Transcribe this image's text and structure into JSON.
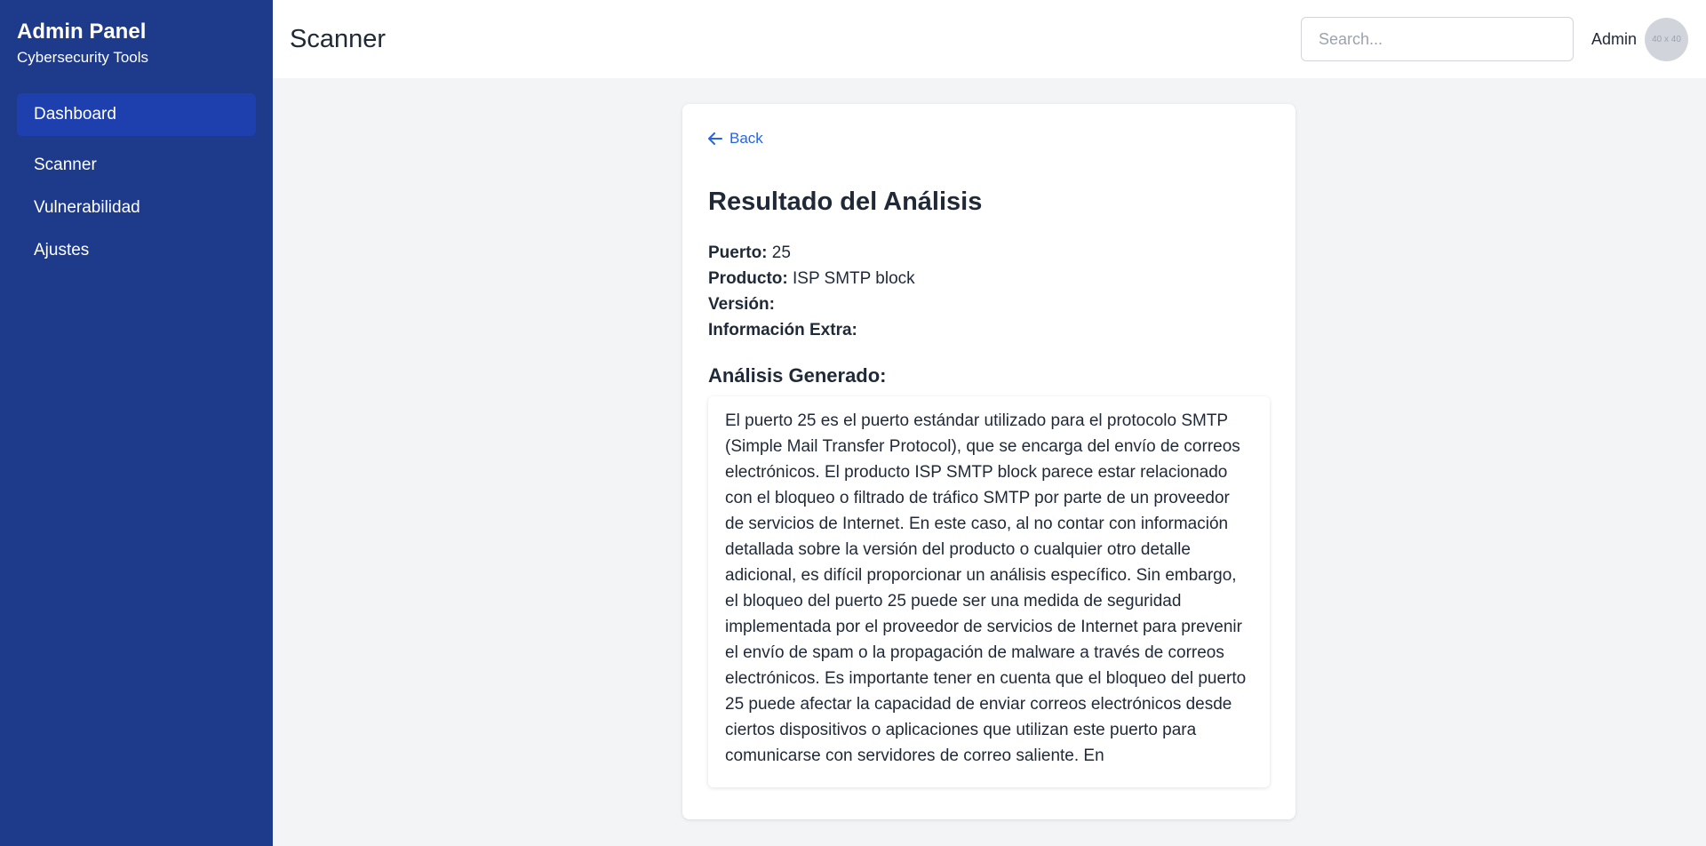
{
  "sidebar": {
    "title": "Admin Panel",
    "subtitle": "Cybersecurity Tools",
    "items": [
      {
        "label": "Dashboard"
      },
      {
        "label": "Scanner"
      },
      {
        "label": "Vulnerabilidad"
      },
      {
        "label": "Ajustes"
      }
    ]
  },
  "header": {
    "title": "Scanner",
    "search_placeholder": "Search...",
    "user_name": "Admin",
    "avatar_text": "40 x 40"
  },
  "result": {
    "back_label": "Back",
    "title": "Resultado del Análisis",
    "fields": [
      {
        "label": "Puerto:",
        "value": "25"
      },
      {
        "label": "Producto:",
        "value": "ISP SMTP block"
      },
      {
        "label": "Versión:",
        "value": ""
      },
      {
        "label": "Información Extra:",
        "value": ""
      }
    ],
    "analysis_heading": "Análisis Generado:",
    "analysis_text": "El puerto 25 es el puerto estándar utilizado para el protocolo SMTP (Simple Mail Transfer Protocol), que se encarga del envío de correos electrónicos. El producto ISP SMTP block parece estar relacionado con el bloqueo o filtrado de tráfico SMTP por parte de un proveedor de servicios de Internet. En este caso, al no contar con información detallada sobre la versión del producto o cualquier otro detalle adicional, es difícil proporcionar un análisis específico. Sin embargo, el bloqueo del puerto 25 puede ser una medida de seguridad implementada por el proveedor de servicios de Internet para prevenir el envío de spam o la propagación de malware a través de correos electrónicos. Es importante tener en cuenta que el bloqueo del puerto 25 puede afectar la capacidad de enviar correos electrónicos desde ciertos dispositivos o aplicaciones que utilizan este puerto para comunicarse con servidores de correo saliente. En"
  },
  "colors": {
    "sidebar_bg": "#1e3a8a",
    "active_item_bg": "#1e40af",
    "link": "#2563eb",
    "page_bg": "#f3f4f6"
  }
}
